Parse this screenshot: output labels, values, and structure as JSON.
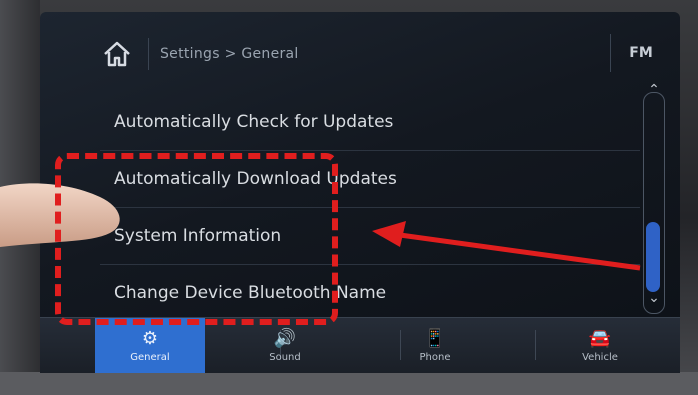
{
  "header": {
    "breadcrumb": "Settings > General",
    "source_button": "FM"
  },
  "list_items": [
    "Automatically Check for Updates",
    "Automatically Download Updates",
    "System Information",
    "Change Device Bluetooth Name"
  ],
  "tabs": [
    {
      "label": "General",
      "icon": "gear-icon",
      "active": true
    },
    {
      "label": "Sound",
      "icon": "speaker-icon",
      "active": false
    },
    {
      "label": "Phone",
      "icon": "phone-icon",
      "active": false
    },
    {
      "label": "Vehicle",
      "icon": "car-icon",
      "active": false
    }
  ],
  "colors": {
    "accent": "#2f6fd0",
    "annotation_red": "#e01e1e"
  }
}
